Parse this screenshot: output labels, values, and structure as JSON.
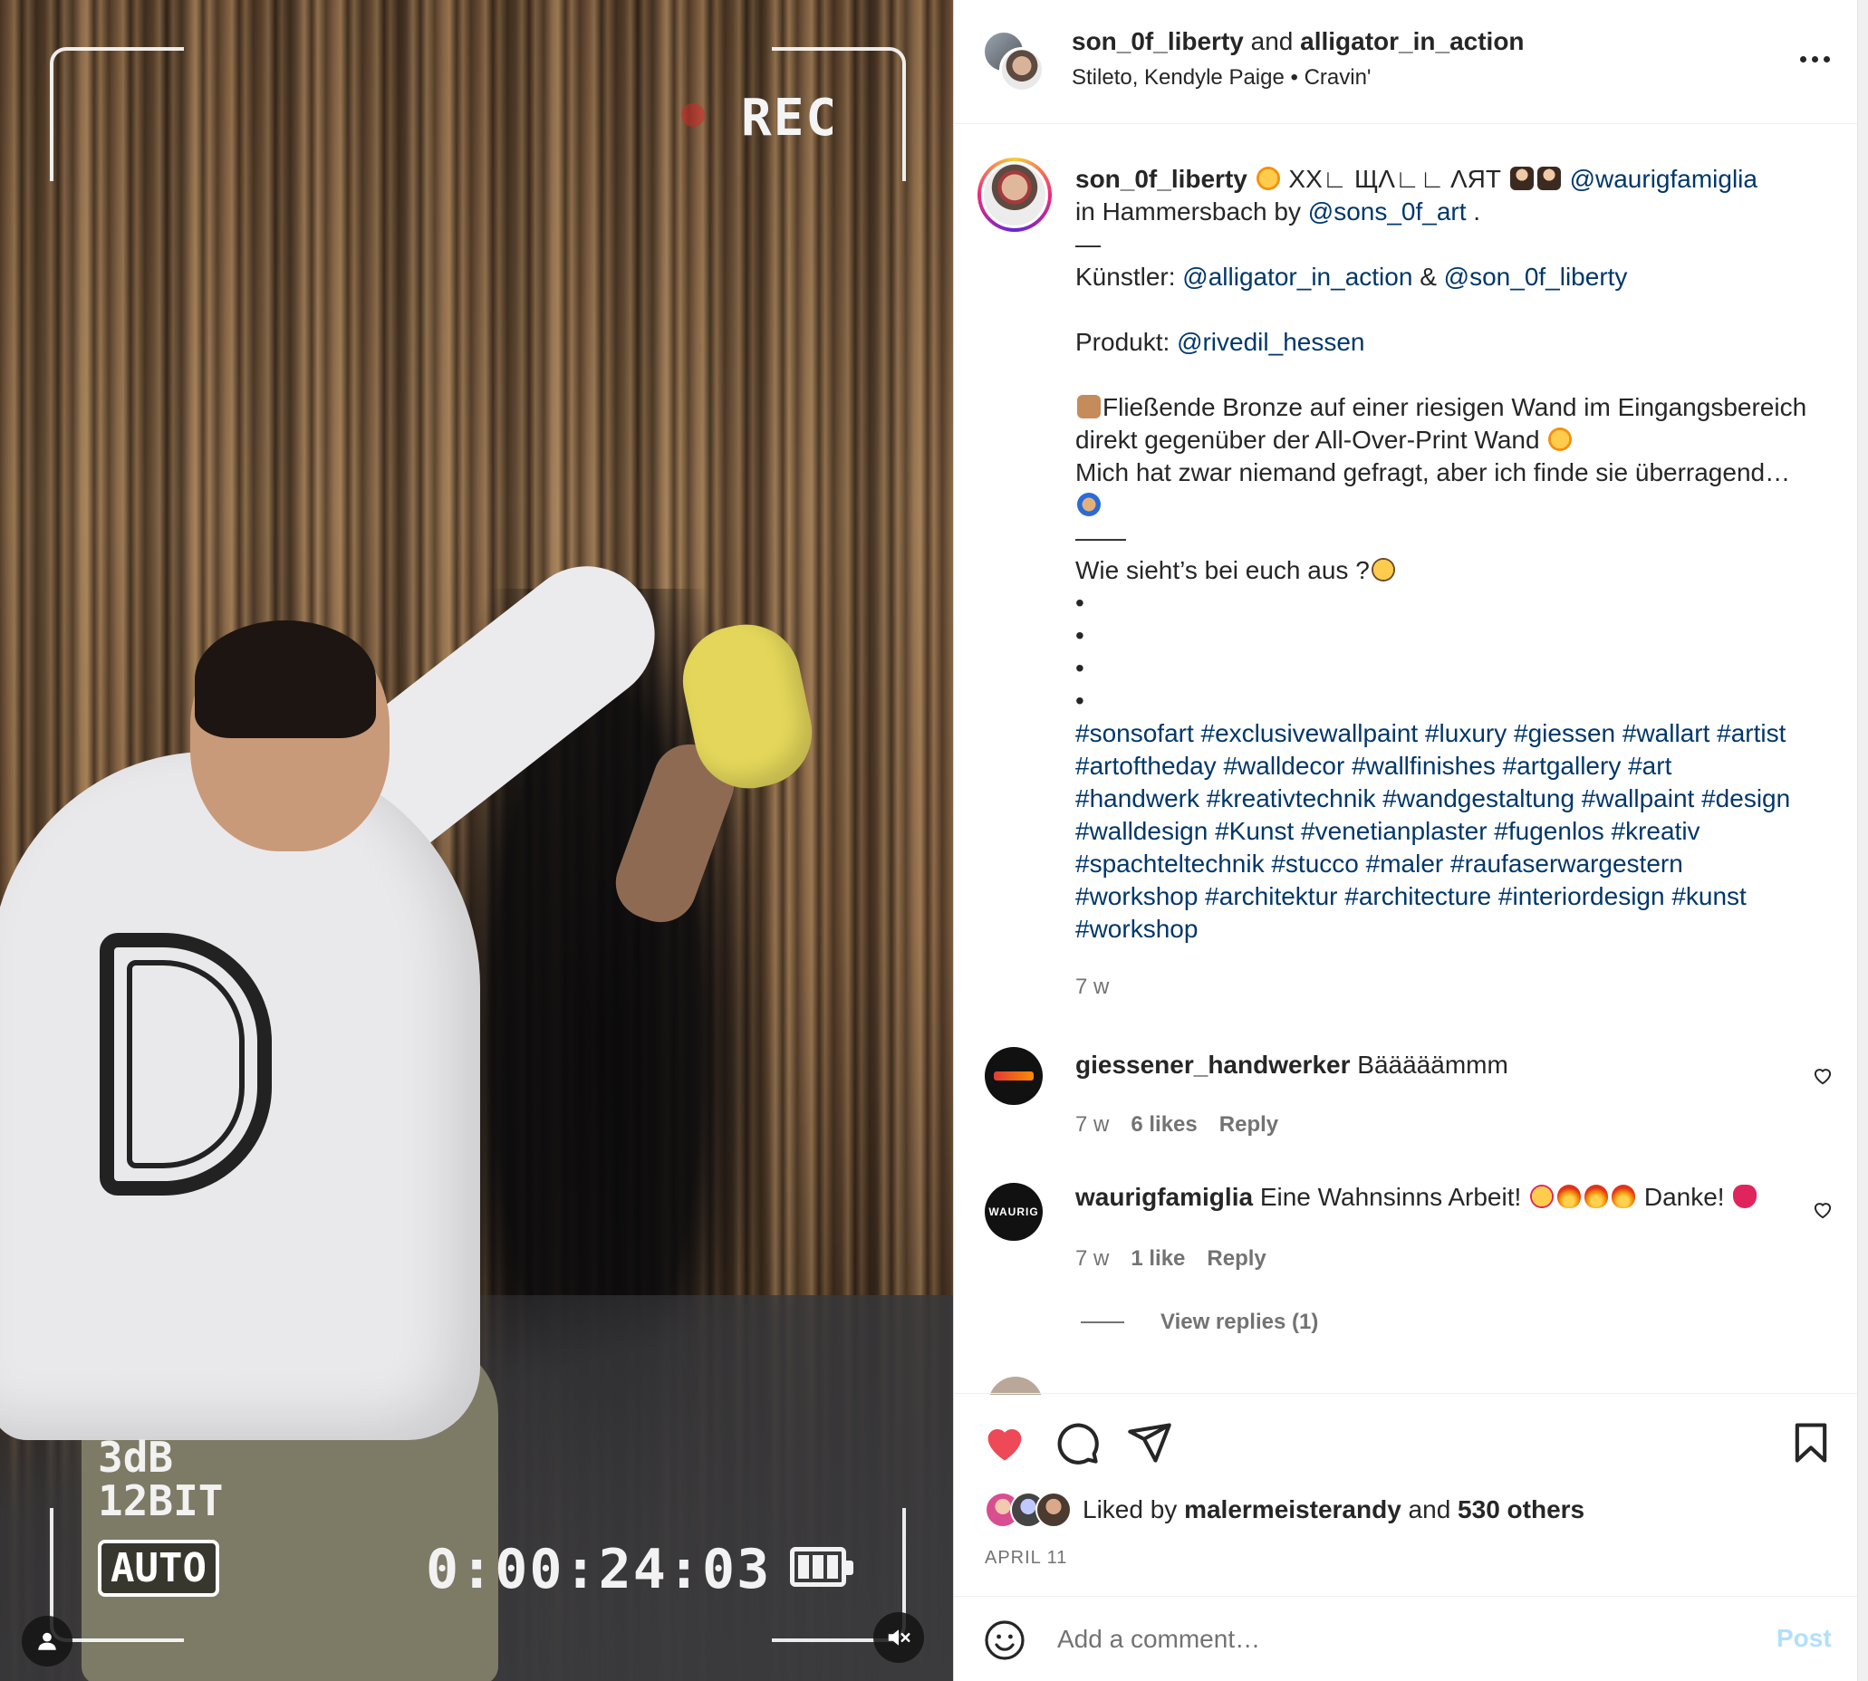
{
  "video": {
    "rec_label": "REC",
    "audio_level": "3dB",
    "bit_depth": "12BIT",
    "mode": "AUTO",
    "timecode": "0:00:24:03",
    "battery_bars": 3,
    "icons": {
      "user": "user-icon",
      "mute": "speaker-muted-icon",
      "battery": "battery-icon"
    }
  },
  "header": {
    "user1": "son_0f_liberty",
    "joiner": "and",
    "user2": "alligator_in_action",
    "audio_artists": "Stileto, Kendyle Paige",
    "separator": "•",
    "audio_track": "Cravin'",
    "more_icon": "more-horizontal-icon"
  },
  "caption": {
    "username": "son_0f_liberty",
    "title_text": "XX∟ ЩΛ∟∟ ΛЯТ",
    "mention_main": "@waurigfamiglia",
    "location_prefix": "in Hammersbach by",
    "mention_sons": "@sons_0f_art",
    "period": ".",
    "dash": "—",
    "artists_label": "Künstler:",
    "artist1": "@alligator_in_action",
    "amp": "&",
    "artist2": "@son_0f_liberty",
    "product_label": "Produkt:",
    "product": "@rivedil_hessen",
    "desc1": "Fließende Bronze auf einer riesigen Wand im Eingangsbereich",
    "desc2": "direkt gegenüber der All-Over-Print Wand",
    "desc3": "Mich hat zwar niemand gefragt, aber ich finde sie überragend…",
    "rule": "——",
    "question": "Wie sieht’s bei euch aus ?",
    "bullet": "•",
    "hashtags": [
      "#sonsofart #exclusivewallpaint #luxury #giessen #wallart #artist",
      "#artoftheday #walldecor #wallfinishes #artgallery #art",
      "#handwerk #kreativtechnik #wandgestaltung #wallpaint #design",
      "#walldesign #Kunst #venetianplaster #fugenlos #kreativ",
      "#spachteltechnik #stucco #maler #raufaserwargestern",
      "#workshop #architektur #architecture #interiordesign #kunst",
      "#workshop"
    ],
    "age": "7 w"
  },
  "comments": [
    {
      "username": "giessener_handwerker",
      "text": "Bääääämmm",
      "age": "7 w",
      "likes": "6 likes",
      "reply": "Reply"
    },
    {
      "username": "waurigfamiglia",
      "text_before": "Eine Wahnsinns Arbeit!",
      "text_after": "Danke!",
      "age": "7 w",
      "likes": "1 like",
      "reply": "Reply",
      "avatar_text": "WAURIG",
      "view_replies": "View replies (1)"
    }
  ],
  "actions": {
    "liked_by_prefix": "Liked by",
    "liked_by_user": "malermeisterandy",
    "liked_by_and": "and",
    "liked_by_others": "530 others",
    "date": "APRIL 11",
    "liked": true,
    "colors": {
      "heart": "#ed4956"
    }
  },
  "composer": {
    "placeholder": "Add a comment…",
    "post_label": "Post"
  }
}
